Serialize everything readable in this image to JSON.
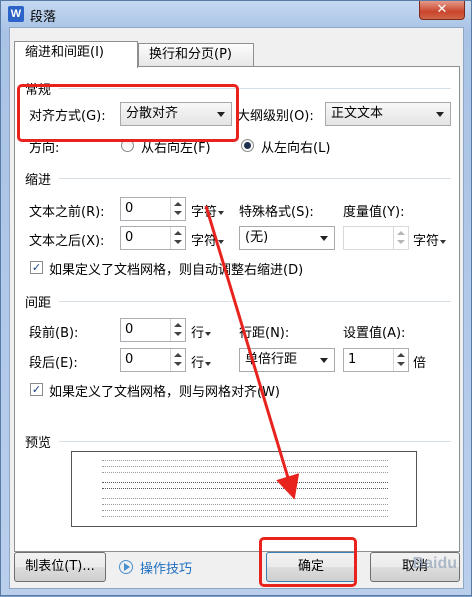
{
  "window": {
    "title": "段落",
    "app_icon": "W",
    "close_glyph": "✕"
  },
  "tabs": [
    {
      "label": "缩进和间距(I)",
      "active": true
    },
    {
      "label": "换行和分页(P)",
      "active": false
    }
  ],
  "general": {
    "section_label": "常规",
    "alignment_label": "对齐方式(G):",
    "alignment_value": "分散对齐",
    "outline_label": "大纲级别(O):",
    "outline_value": "正文文本",
    "direction_label": "方向:",
    "rtl_label": "从右向左(F)",
    "ltr_label": "从左向右(L)",
    "direction_selected": "ltr"
  },
  "indent": {
    "section_label": "缩进",
    "before_label": "文本之前(R):",
    "before_value": "0",
    "before_unit": "字符",
    "after_label": "文本之后(X):",
    "after_value": "0",
    "after_unit": "字符",
    "special_label": "特殊格式(S):",
    "special_value": "(无)",
    "measure_label": "度量值(Y):",
    "measure_value": "",
    "measure_unit": "字符",
    "auto_adjust_label": "如果定义了文档网格，则自动调整右缩进(D)",
    "auto_adjust_checked": true
  },
  "spacing": {
    "section_label": "间距",
    "before_label": "段前(B):",
    "before_value": "0",
    "before_unit": "行",
    "after_label": "段后(E):",
    "after_value": "0",
    "after_unit": "行",
    "line_label": "行距(N):",
    "line_value": "单倍行距",
    "setting_label": "设置值(A):",
    "setting_value": "1",
    "setting_unit": "倍",
    "snap_grid_label": "如果定义了文档网格，则与网格对齐(W)",
    "snap_grid_checked": true
  },
  "preview": {
    "section_label": "预览",
    "sample_text": "前一段落前一段落前一段落前一段落前一段落前一段落前一段落前一段落前一段落前一段落"
  },
  "footer": {
    "tabs_button": "制表位(T)...",
    "tips_link": "操作技巧",
    "ok_button": "确定",
    "cancel_button": "取消"
  },
  "watermark": "Baidu",
  "colors": {
    "annotation_red": "#e8231e",
    "link_blue": "#1f6fc0"
  }
}
